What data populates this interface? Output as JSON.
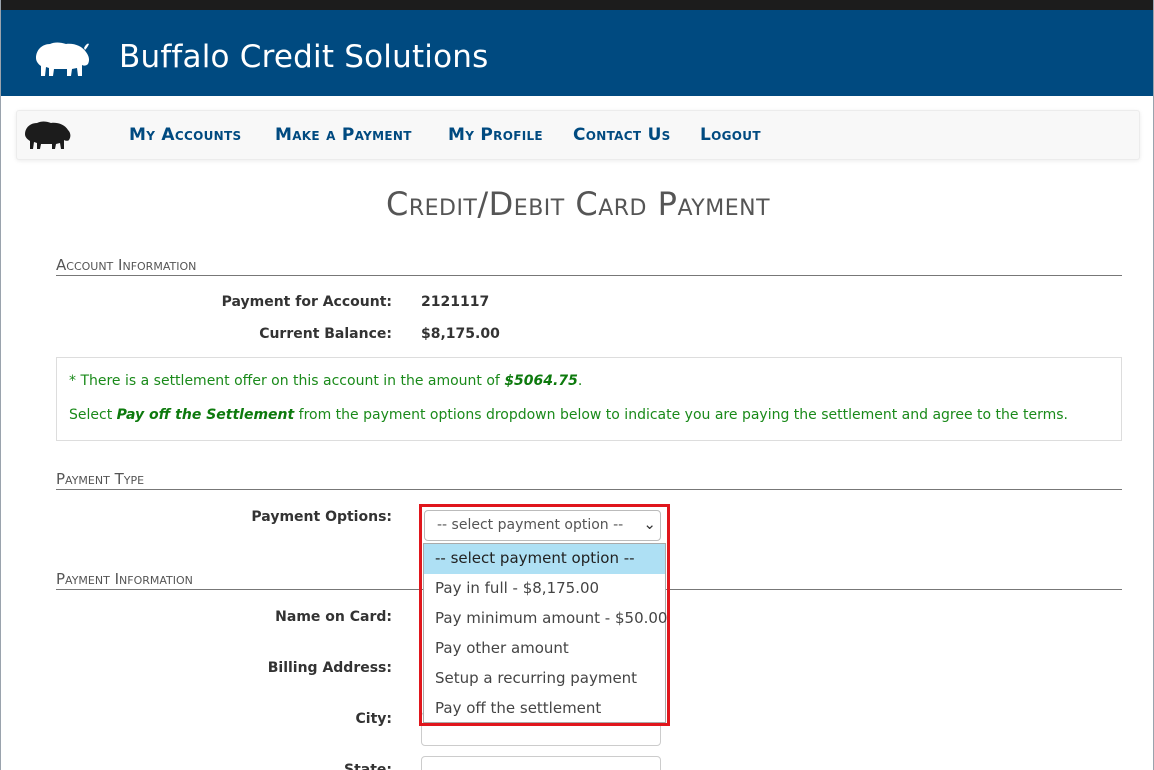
{
  "brand": {
    "title": "Buffalo Credit Solutions"
  },
  "nav": {
    "items": [
      {
        "label": "My Accounts"
      },
      {
        "label": "Make a Payment"
      },
      {
        "label": "My Profile"
      },
      {
        "label": "Contact Us"
      },
      {
        "label": "Logout"
      }
    ]
  },
  "page": {
    "title": "Credit/Debit Card Payment"
  },
  "account_info": {
    "heading": "Account Information",
    "account_label": "Payment for Account:",
    "account_value": "2121117",
    "balance_label": "Current Balance:",
    "balance_value": "$8,175.00"
  },
  "notice": {
    "line1_prefix": "* There is a settlement offer on this account in the amount of ",
    "line1_amount": "$5064.75",
    "line1_suffix": ".",
    "line2_prefix": "Select ",
    "line2_emphasis": "Pay off the Settlement",
    "line2_suffix": " from the payment options dropdown below to indicate you are paying the settlement and agree to the terms."
  },
  "payment_type": {
    "heading": "Payment Type",
    "options_label": "Payment Options:",
    "selected": "-- select payment option --",
    "options": [
      "-- select payment option --",
      "Pay in full - $8,175.00",
      "Pay minimum amount - $50.00",
      "Pay other amount",
      "Setup a recurring payment",
      "Pay off the settlement"
    ]
  },
  "payment_info": {
    "heading": "Payment Information",
    "name_label": "Name on Card:",
    "address_label": "Billing Address:",
    "city_label": "City:",
    "state_label": "State:"
  },
  "colors": {
    "brand_blue": "#004a80",
    "notice_green": "#1a8a1a",
    "highlight_red": "#e0161c",
    "option_selected": "#aee0f4"
  }
}
